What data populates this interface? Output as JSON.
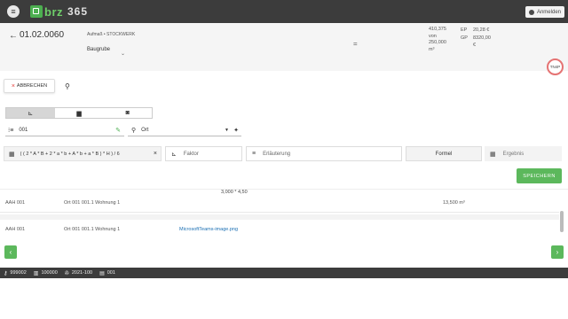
{
  "app": {
    "logo_primary": "brz",
    "logo_secondary": "365",
    "user_button": "Anmelden"
  },
  "header": {
    "doc_number": "01.02.0060",
    "breadcrumb": "Aufmaß • STOCKWERK",
    "section": "Baugrube",
    "stats_col1": [
      "410,375",
      "von",
      "250,000",
      "m³"
    ],
    "stats_col2": [
      "EP",
      "GP"
    ],
    "stats_col3": [
      "20,28 €",
      "8320,00",
      "€"
    ],
    "avatar_initials": "TN4P"
  },
  "toolbar": {
    "cancel_label": "ABBRECHEN",
    "tabs": [
      "ruler-icon",
      "comment-icon",
      "camera-icon"
    ]
  },
  "selectors": {
    "position_value": "001",
    "location_value": "Ort"
  },
  "formula": {
    "value": "( ( 2 * A * B + 2 * a * b + A * b + a * B ) * H ) / 6",
    "factor_placeholder": "Faktor",
    "explanation_placeholder": "Erläuterung",
    "formel_label": "Formel",
    "result_placeholder": "Ergebnis",
    "save_label": "SPEICHERN"
  },
  "list": {
    "top_value": "3,000 * 4,50",
    "rows": [
      {
        "col1": "AAH 001",
        "col2": "Ort 001 001.1 Wohnung 1",
        "col3": "",
        "col4": "13,500  m³"
      },
      {
        "col1": "AAH 001",
        "col2": "Ort 001 001.1 Wohnung 1",
        "col3": "MicrosoftTeams-image.png",
        "col4": ""
      }
    ]
  },
  "statusbar": {
    "item1": "999002",
    "item2": "100000",
    "item3": "2021-100",
    "item4": "001"
  },
  "colors": {
    "topbar": "#3c3c3c",
    "accent_green": "#5cb85c",
    "link_blue": "#1a6fb3",
    "cancel_red": "#e53935"
  }
}
